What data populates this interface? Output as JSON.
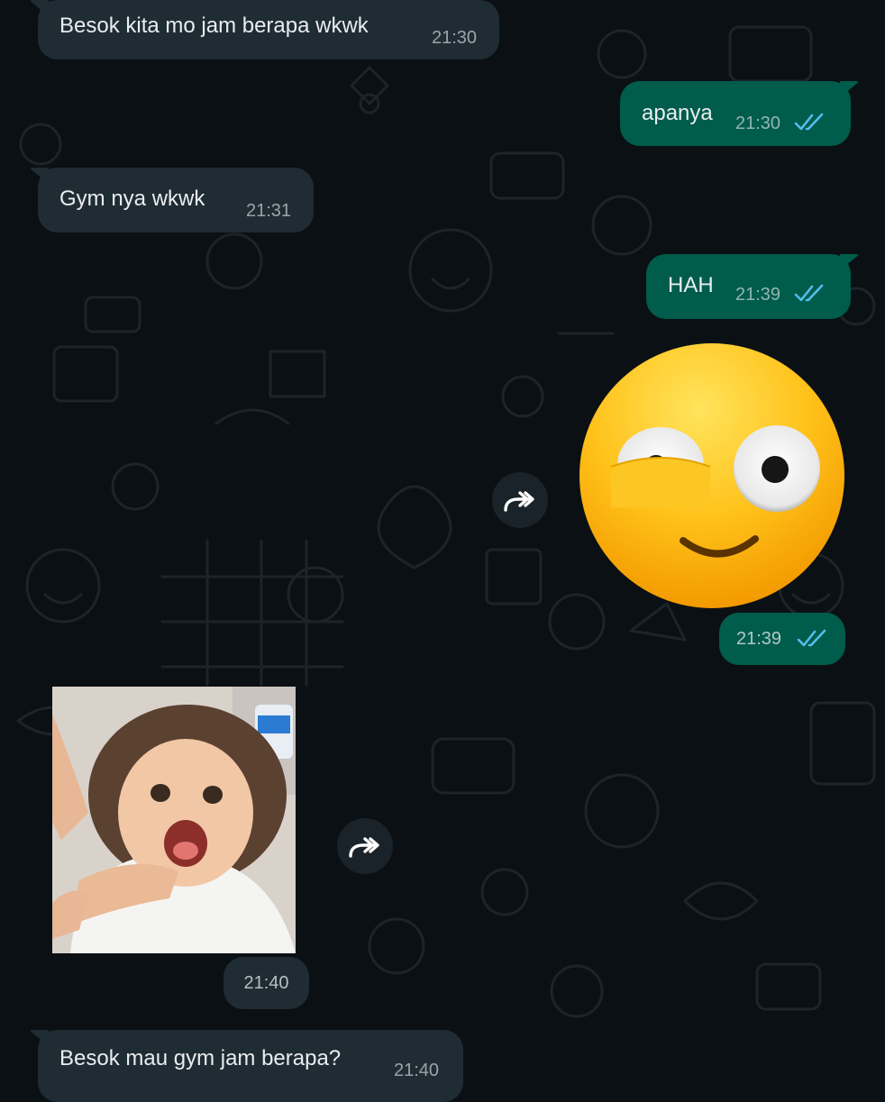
{
  "messages": [
    {
      "id": "m1",
      "direction": "incoming",
      "text": "Besok kita mo jam berapa wkwk",
      "time": "21:30"
    },
    {
      "id": "m2",
      "direction": "outgoing",
      "text": "apanya",
      "time": "21:30",
      "status": "read"
    },
    {
      "id": "m3",
      "direction": "incoming",
      "text": "Gym nya wkwk",
      "time": "21:31"
    },
    {
      "id": "m4",
      "direction": "outgoing",
      "text": "HAH",
      "time": "21:39",
      "status": "read"
    },
    {
      "id": "m5",
      "direction": "outgoing",
      "type": "sticker",
      "sticker": "flushed-smiling-emoji",
      "time": "21:39",
      "status": "read"
    },
    {
      "id": "m6",
      "direction": "incoming",
      "type": "sticker",
      "sticker": "shocked-child-photo",
      "time": "21:40"
    },
    {
      "id": "m7",
      "direction": "incoming",
      "text": "Besok mau gym jam berapa?",
      "time": "21:40"
    }
  ],
  "icons": {
    "forward": "forward-icon",
    "read_receipt": "double-check-icon"
  },
  "colors": {
    "background": "#0b1014",
    "incoming_bubble": "#1f2c34",
    "outgoing_bubble": "#005c4b",
    "read_tick": "#53bdeb",
    "text": "#e9edef"
  }
}
